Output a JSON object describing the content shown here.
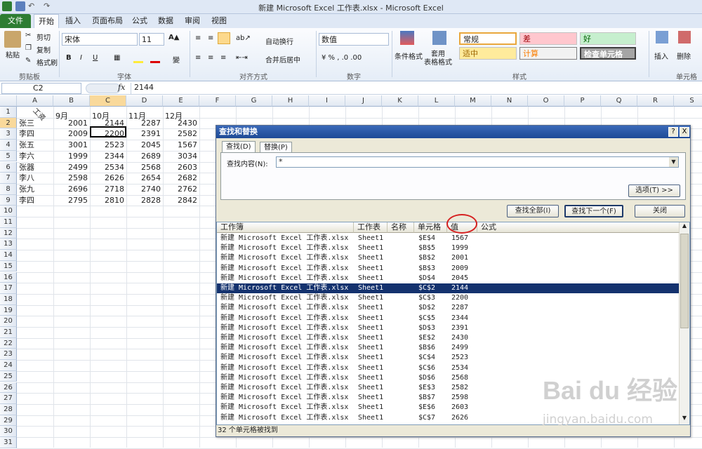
{
  "title": "新建 Microsoft Excel 工作表.xlsx - Microsoft Excel",
  "tabs": [
    "文件",
    "开始",
    "插入",
    "页面布局",
    "公式",
    "数据",
    "审阅",
    "视图"
  ],
  "ribbon": {
    "paste": "粘贴",
    "cut": "剪切",
    "copy": "复制",
    "format_painter": "格式刷",
    "clipboard": "剪贴板",
    "font_name": "宋体",
    "font_size": "11",
    "font_group": "字体",
    "wrap": "自动换行",
    "merge": "合并后居中",
    "align_group": "对齐方式",
    "number_format": "数值",
    "number_group": "数字",
    "cond_format": "条件格式",
    "table_format": "套用\n表格格式",
    "styles_group": "样式",
    "style_normal": "常规",
    "style_bad": "差",
    "style_good": "好",
    "style_neutral": "适中",
    "style_calc": "计算",
    "style_check": "检查单元格",
    "insert": "插入",
    "delete": "删除",
    "cells_group": "单元格"
  },
  "formula_bar": {
    "name": "C2",
    "fx": "fx",
    "value": "2144"
  },
  "columns": [
    "A",
    "B",
    "C",
    "D",
    "E",
    "F",
    "G",
    "H",
    "I",
    "J",
    "K",
    "L",
    "M",
    "N",
    "O",
    "P",
    "Q",
    "R",
    "S"
  ],
  "rows": [
    "1",
    "2",
    "3",
    "4",
    "5",
    "6",
    "7",
    "8",
    "9",
    "10",
    "11",
    "12",
    "13",
    "14",
    "15",
    "16",
    "17",
    "18",
    "19",
    "20",
    "21",
    "22",
    "23",
    "24",
    "25",
    "26",
    "27",
    "28",
    "29",
    "30",
    "31"
  ],
  "sheet": {
    "corner": "工资",
    "months": [
      "9月",
      "10月",
      "11月",
      "12月"
    ],
    "names": [
      "张三",
      "李四",
      "张五",
      "李六",
      "张器",
      "李八",
      "张九",
      "李四"
    ],
    "values": [
      [
        "2001",
        "2144",
        "2287",
        "2430"
      ],
      [
        "2009",
        "2200",
        "2391",
        "2582"
      ],
      [
        "3001",
        "2523",
        "2045",
        "1567"
      ],
      [
        "1999",
        "2344",
        "2689",
        "3034"
      ],
      [
        "2499",
        "2534",
        "2568",
        "2603"
      ],
      [
        "2598",
        "2626",
        "2654",
        "2682"
      ],
      [
        "2696",
        "2718",
        "2740",
        "2762"
      ],
      [
        "2795",
        "2810",
        "2828",
        "2842"
      ]
    ]
  },
  "dialog": {
    "title": "查找和替换",
    "help": "?",
    "close": "X",
    "tab_find": "查找(D)",
    "tab_replace": "替换(P)",
    "find_label": "查找内容(N):",
    "find_value": "*",
    "options": "选项(T) >>",
    "find_all": "查找全部(I)",
    "find_next": "查找下一个(F)",
    "close_btn": "关闭",
    "headers": [
      "工作簿",
      "工作表",
      "名称",
      "单元格",
      "值",
      "公式"
    ],
    "results": [
      [
        "新建 Microsoft Excel 工作表.xlsx",
        "Sheet1",
        "",
        "$E$4",
        "1567"
      ],
      [
        "新建 Microsoft Excel 工作表.xlsx",
        "Sheet1",
        "",
        "$B$5",
        "1999"
      ],
      [
        "新建 Microsoft Excel 工作表.xlsx",
        "Sheet1",
        "",
        "$B$2",
        "2001"
      ],
      [
        "新建 Microsoft Excel 工作表.xlsx",
        "Sheet1",
        "",
        "$B$3",
        "2009"
      ],
      [
        "新建 Microsoft Excel 工作表.xlsx",
        "Sheet1",
        "",
        "$D$4",
        "2045"
      ],
      [
        "新建 Microsoft Excel 工作表.xlsx",
        "Sheet1",
        "",
        "$C$2",
        "2144"
      ],
      [
        "新建 Microsoft Excel 工作表.xlsx",
        "Sheet1",
        "",
        "$C$3",
        "2200"
      ],
      [
        "新建 Microsoft Excel 工作表.xlsx",
        "Sheet1",
        "",
        "$D$2",
        "2287"
      ],
      [
        "新建 Microsoft Excel 工作表.xlsx",
        "Sheet1",
        "",
        "$C$5",
        "2344"
      ],
      [
        "新建 Microsoft Excel 工作表.xlsx",
        "Sheet1",
        "",
        "$D$3",
        "2391"
      ],
      [
        "新建 Microsoft Excel 工作表.xlsx",
        "Sheet1",
        "",
        "$E$2",
        "2430"
      ],
      [
        "新建 Microsoft Excel 工作表.xlsx",
        "Sheet1",
        "",
        "$B$6",
        "2499"
      ],
      [
        "新建 Microsoft Excel 工作表.xlsx",
        "Sheet1",
        "",
        "$C$4",
        "2523"
      ],
      [
        "新建 Microsoft Excel 工作表.xlsx",
        "Sheet1",
        "",
        "$C$6",
        "2534"
      ],
      [
        "新建 Microsoft Excel 工作表.xlsx",
        "Sheet1",
        "",
        "$D$6",
        "2568"
      ],
      [
        "新建 Microsoft Excel 工作表.xlsx",
        "Sheet1",
        "",
        "$E$3",
        "2582"
      ],
      [
        "新建 Microsoft Excel 工作表.xlsx",
        "Sheet1",
        "",
        "$B$7",
        "2598"
      ],
      [
        "新建 Microsoft Excel 工作表.xlsx",
        "Sheet1",
        "",
        "$E$6",
        "2603"
      ],
      [
        "新建 Microsoft Excel 工作表.xlsx",
        "Sheet1",
        "",
        "$C$7",
        "2626"
      ]
    ],
    "selected_index": 5,
    "status": "32 个单元格被找到"
  },
  "watermark": {
    "brand": "Bai du 经验",
    "url": "jingyan.baidu.com"
  },
  "colors": {
    "file_tab": "#2e7d32",
    "selection": "#14326e",
    "title_bar": "#2a579a"
  }
}
